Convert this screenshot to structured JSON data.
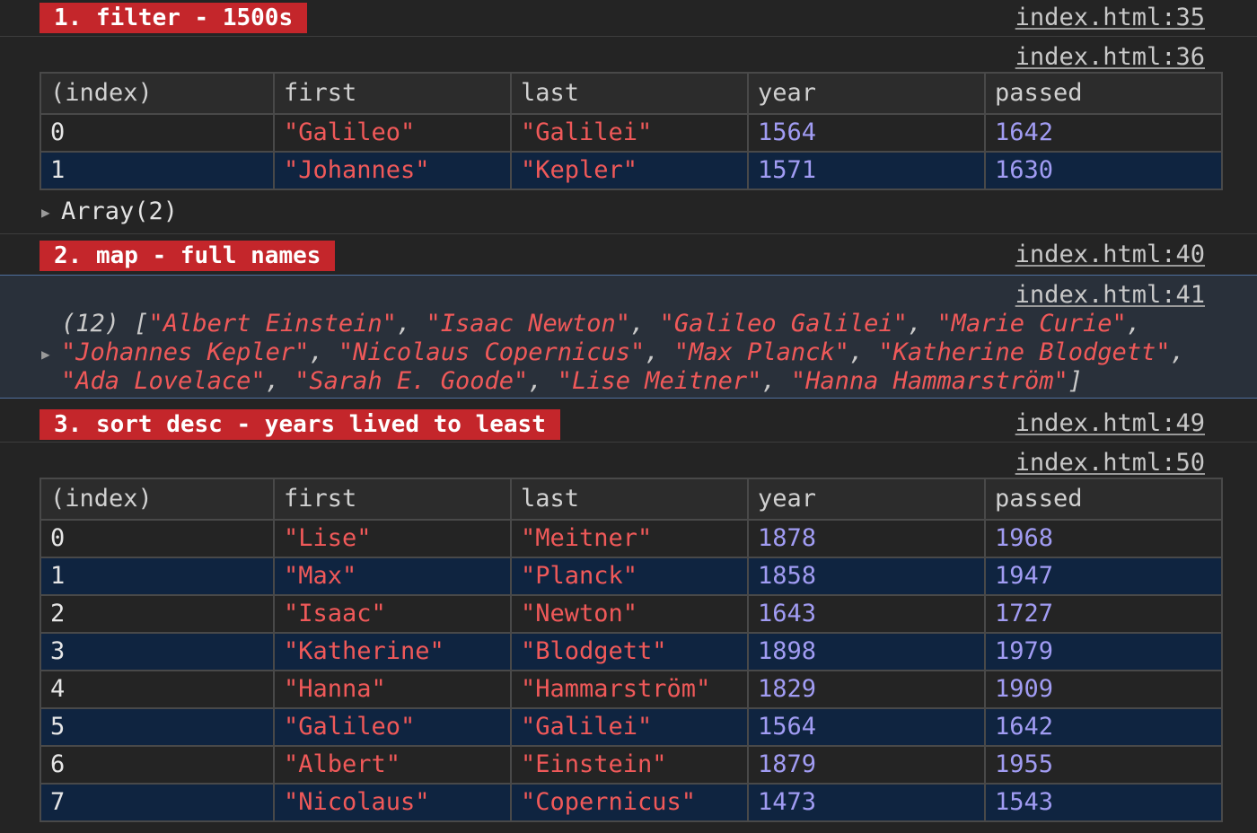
{
  "groups": [
    {
      "label": "1. filter - 1500s",
      "source": "index.html:35",
      "table_source": "index.html:36",
      "columns": [
        "(index)",
        "first",
        "last",
        "year",
        "passed"
      ],
      "rows": [
        [
          "0",
          "\"Galileo\"",
          "\"Galilei\"",
          "1564",
          "1642"
        ],
        [
          "1",
          "\"Johannes\"",
          "\"Kepler\"",
          "1571",
          "1630"
        ]
      ],
      "array_summary": "Array(2)"
    },
    {
      "label": "2. map - full names",
      "source": "index.html:40",
      "array_source": "index.html:41",
      "array_prefix": "(12) [",
      "names": [
        "Albert Einstein",
        "Isaac Newton",
        "Galileo Galilei",
        "Marie Curie",
        "Johannes Kepler",
        "Nicolaus Copernicus",
        "Max Planck",
        "Katherine Blodgett",
        "Ada Lovelace",
        "Sarah E. Goode",
        "Lise Meitner",
        "Hanna Hammarström"
      ],
      "array_suffix": "]"
    },
    {
      "label": "3. sort desc - years lived to least",
      "source": "index.html:49",
      "table_source": "index.html:50",
      "columns": [
        "(index)",
        "first",
        "last",
        "year",
        "passed"
      ],
      "rows": [
        [
          "0",
          "\"Lise\"",
          "\"Meitner\"",
          "1878",
          "1968"
        ],
        [
          "1",
          "\"Max\"",
          "\"Planck\"",
          "1858",
          "1947"
        ],
        [
          "2",
          "\"Isaac\"",
          "\"Newton\"",
          "1643",
          "1727"
        ],
        [
          "3",
          "\"Katherine\"",
          "\"Blodgett\"",
          "1898",
          "1979"
        ],
        [
          "4",
          "\"Hanna\"",
          "\"Hammarström\"",
          "1829",
          "1909"
        ],
        [
          "5",
          "\"Galileo\"",
          "\"Galilei\"",
          "1564",
          "1642"
        ],
        [
          "6",
          "\"Albert\"",
          "\"Einstein\"",
          "1879",
          "1955"
        ],
        [
          "7",
          "\"Nicolaus\"",
          "\"Copernicus\"",
          "1473",
          "1543"
        ]
      ]
    }
  ],
  "colors": {
    "label_bg": "#c4262b",
    "string": "#f05959",
    "number": "#a19cf3",
    "row_highlight": "#0f2440"
  }
}
